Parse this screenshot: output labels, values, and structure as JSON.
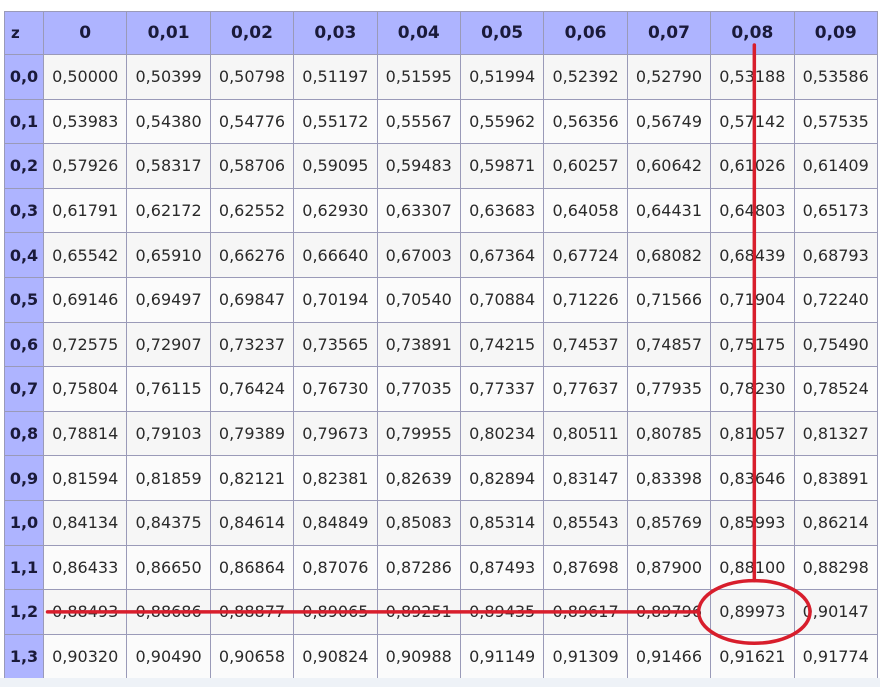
{
  "table": {
    "corner": "z",
    "columns": [
      "0",
      "0,01",
      "0,02",
      "0,03",
      "0,04",
      "0,05",
      "0,06",
      "0,07",
      "0,08",
      "0,09"
    ],
    "rows": [
      {
        "z": "0,0",
        "values": [
          "0,50000",
          "0,50399",
          "0,50798",
          "0,51197",
          "0,51595",
          "0,51994",
          "0,52392",
          "0,52790",
          "0,53188",
          "0,53586"
        ]
      },
      {
        "z": "0,1",
        "values": [
          "0,53983",
          "0,54380",
          "0,54776",
          "0,55172",
          "0,55567",
          "0,55962",
          "0,56356",
          "0,56749",
          "0,57142",
          "0,57535"
        ]
      },
      {
        "z": "0,2",
        "values": [
          "0,57926",
          "0,58317",
          "0,58706",
          "0,59095",
          "0,59483",
          "0,59871",
          "0,60257",
          "0,60642",
          "0,61026",
          "0,61409"
        ]
      },
      {
        "z": "0,3",
        "values": [
          "0,61791",
          "0,62172",
          "0,62552",
          "0,62930",
          "0,63307",
          "0,63683",
          "0,64058",
          "0,64431",
          "0,64803",
          "0,65173"
        ]
      },
      {
        "z": "0,4",
        "values": [
          "0,65542",
          "0,65910",
          "0,66276",
          "0,66640",
          "0,67003",
          "0,67364",
          "0,67724",
          "0,68082",
          "0,68439",
          "0,68793"
        ]
      },
      {
        "z": "0,5",
        "values": [
          "0,69146",
          "0,69497",
          "0,69847",
          "0,70194",
          "0,70540",
          "0,70884",
          "0,71226",
          "0,71566",
          "0,71904",
          "0,72240"
        ]
      },
      {
        "z": "0,6",
        "values": [
          "0,72575",
          "0,72907",
          "0,73237",
          "0,73565",
          "0,73891",
          "0,74215",
          "0,74537",
          "0,74857",
          "0,75175",
          "0,75490"
        ]
      },
      {
        "z": "0,7",
        "values": [
          "0,75804",
          "0,76115",
          "0,76424",
          "0,76730",
          "0,77035",
          "0,77337",
          "0,77637",
          "0,77935",
          "0,78230",
          "0,78524"
        ]
      },
      {
        "z": "0,8",
        "values": [
          "0,78814",
          "0,79103",
          "0,79389",
          "0,79673",
          "0,79955",
          "0,80234",
          "0,80511",
          "0,80785",
          "0,81057",
          "0,81327"
        ]
      },
      {
        "z": "0,9",
        "values": [
          "0,81594",
          "0,81859",
          "0,82121",
          "0,82381",
          "0,82639",
          "0,82894",
          "0,83147",
          "0,83398",
          "0,83646",
          "0,83891"
        ]
      },
      {
        "z": "1,0",
        "values": [
          "0,84134",
          "0,84375",
          "0,84614",
          "0,84849",
          "0,85083",
          "0,85314",
          "0,85543",
          "0,85769",
          "0,85993",
          "0,86214"
        ]
      },
      {
        "z": "1,1",
        "values": [
          "0,86433",
          "0,86650",
          "0,86864",
          "0,87076",
          "0,87286",
          "0,87493",
          "0,87698",
          "0,87900",
          "0,88100",
          "0,88298"
        ]
      },
      {
        "z": "1,2",
        "values": [
          "0,88493",
          "0,88686",
          "0,88877",
          "0,89065",
          "0,89251",
          "0,89435",
          "0,89617",
          "0,89796",
          "0,89973",
          "0,90147"
        ]
      },
      {
        "z": "1,3",
        "values": [
          "0,90320",
          "0,90490",
          "0,90658",
          "0,90824",
          "0,90988",
          "0,91149",
          "0,91309",
          "0,91466",
          "0,91621",
          "0,91774"
        ]
      }
    ]
  },
  "highlight": {
    "row_z": "1,2",
    "column": "0,08",
    "value": "0,89973",
    "color": "#d81e2c"
  }
}
